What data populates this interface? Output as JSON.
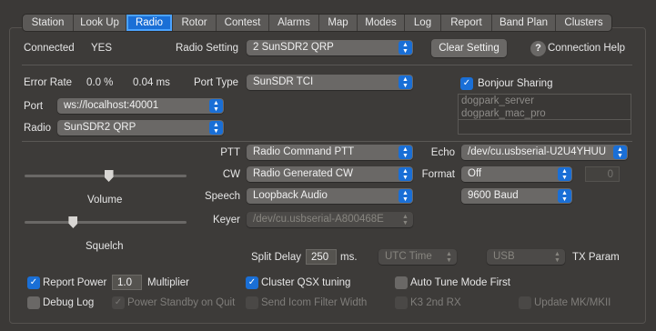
{
  "tabs": [
    {
      "label": "Station",
      "w": 56
    },
    {
      "label": "Look Up",
      "w": 58
    },
    {
      "label": "Radio",
      "w": 51,
      "active": true
    },
    {
      "label": "Rotor",
      "w": 48
    },
    {
      "label": "Contest",
      "w": 58
    },
    {
      "label": "Alarms",
      "w": 55
    },
    {
      "label": "Map",
      "w": 42
    },
    {
      "label": "Modes",
      "w": 52
    },
    {
      "label": "Log",
      "w": 40
    },
    {
      "label": "Report",
      "w": 56
    },
    {
      "label": "Band Plan",
      "w": 70
    },
    {
      "label": "Clusters",
      "w": 61
    }
  ],
  "status": {
    "connected_label": "Connected",
    "connected_value": "YES",
    "radio_setting_label": "Radio Setting",
    "radio_setting_value": "2 SunSDR2 QRP",
    "clear_setting": "Clear Setting",
    "help_glyph": "?",
    "connection_help": "Connection Help"
  },
  "error": {
    "label": "Error Rate",
    "value": "0.0 %",
    "ms": "0.04 ms"
  },
  "port_type": {
    "label": "Port Type",
    "value": "SunSDR TCI"
  },
  "port": {
    "label": "Port",
    "value": "ws://localhost:40001"
  },
  "radio": {
    "label": "Radio",
    "value": "SunSDR2 QRP"
  },
  "bonjour": {
    "label": "Bonjour Sharing",
    "items": [
      "dogpark_server",
      "dogpark_mac_pro"
    ]
  },
  "controls": {
    "ptt_label": "PTT",
    "ptt_value": "Radio Command PTT",
    "cw_label": "CW",
    "cw_value": "Radio Generated CW",
    "speech_label": "Speech",
    "speech_value": "Loopback Audio",
    "keyer_label": "Keyer",
    "keyer_value": "/dev/cu.usbserial-A800468E",
    "echo_label": "Echo",
    "echo_value": "/dev/cu.usbserial-U2U4YHUU",
    "format_label": "Format",
    "format_value": "Off",
    "format_number": "0",
    "baud_value": "9600 Baud"
  },
  "sliders": {
    "volume_label": "Volume",
    "volume_level": 0.52,
    "squelch_label": "Squelch",
    "squelch_level": 0.3
  },
  "split": {
    "label": "Split Delay",
    "value": "250",
    "unit": "ms.",
    "utc_value": "UTC Time",
    "usb_value": "USB",
    "tx_param": "TX Param"
  },
  "options": {
    "report_power": "Report Power",
    "report_power_value": "1.0",
    "multiplier": "Multiplier",
    "cluster_qsx": "Cluster QSX tuning",
    "auto_tune": "Auto Tune Mode First",
    "debug_log": "Debug Log",
    "power_standby": "Power Standby on Quit",
    "send_icom": "Send Icom Filter Width",
    "k3_2nd_rx": "K3 2nd RX",
    "update_mk": "Update MK/MKII"
  },
  "colors": {
    "accent": "#1a6fd6",
    "background": "#3b3937"
  }
}
